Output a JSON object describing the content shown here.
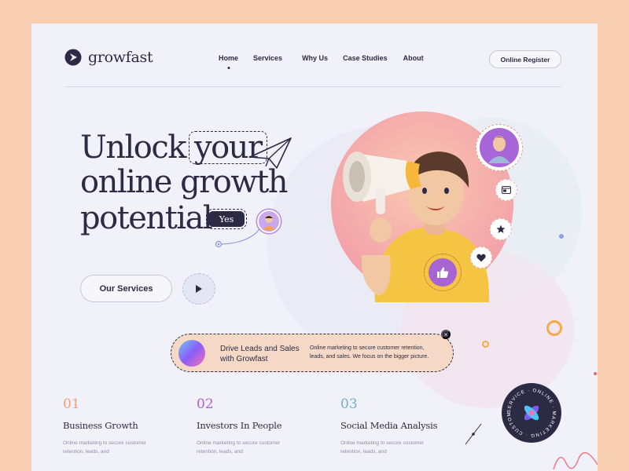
{
  "brand": {
    "name": "growfast"
  },
  "nav": {
    "items": [
      {
        "label": "Home",
        "active": true
      },
      {
        "label": "Services",
        "active": false
      },
      {
        "label": "Why Us",
        "active": false
      },
      {
        "label": "Case Studies",
        "active": false
      },
      {
        "label": "About",
        "active": false
      }
    ],
    "register_label": "Online Register"
  },
  "hero": {
    "line1_a": "Unlock",
    "line1_b": "your",
    "line2": "online growth",
    "line3": "potential",
    "badge": "Yes",
    "services_label": "Our Services"
  },
  "banner": {
    "title": "Drive Leads and Sales with Growfast",
    "text": "Online marketing to secure customer retention, leads, and sales. We focus on the bigger picture."
  },
  "features": [
    {
      "number": "01",
      "title": "Business Growth",
      "text": "Online marketing to secure customer retention, leads, and"
    },
    {
      "number": "02",
      "title": "Investors In People",
      "text": "Online marketing to secure customer retention, leads, and"
    },
    {
      "number": "03",
      "title": "Social Media Analysis",
      "text": "Online marketing to secure customer retention, leads, and"
    }
  ],
  "circle_badge": {
    "text": "SERVICE · ONLINE · MARKETING · CUSTOMER ·"
  },
  "icons": [
    "growfast-logo-icon",
    "paper-plane-icon",
    "play-icon",
    "megaphone-icon",
    "browser-icon",
    "star-icon",
    "heart-icon",
    "thumbs-up-icon",
    "close-icon"
  ],
  "colors": {
    "dark": "#2b2c44",
    "background": "#f1f1fa",
    "accent_purple": "#a764d5",
    "accent_orange": "#f6a94a",
    "peach": "#f8cfb0",
    "num01": "#f0a07f",
    "num02": "#b15fd2",
    "num03": "#6cb3c9"
  }
}
